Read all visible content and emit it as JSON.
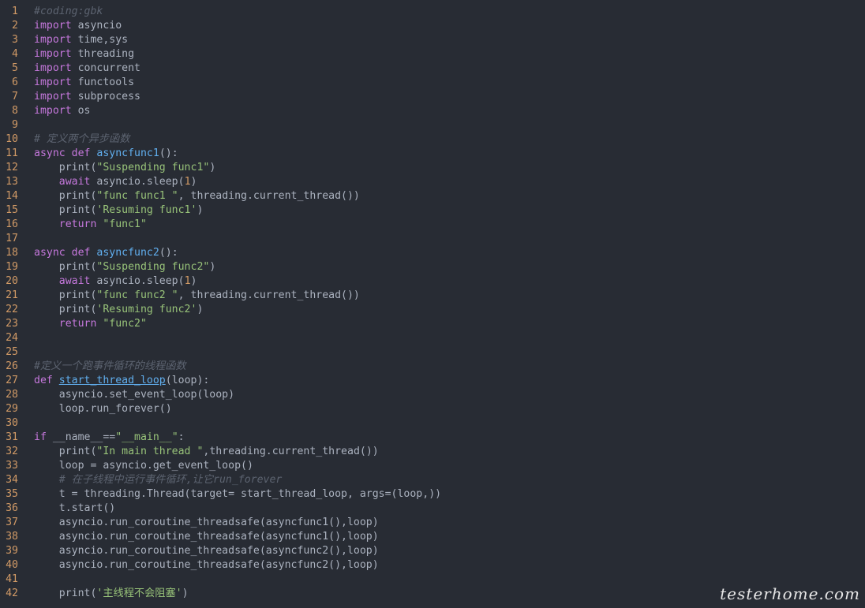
{
  "colors": {
    "background": "#282c34",
    "line_number": "#d19a66",
    "keyword": "#c678dd",
    "function": "#61afef",
    "string": "#98c379",
    "number": "#d19a66",
    "comment": "#5c6370",
    "text": "#abb2bf"
  },
  "lines": [
    {
      "n": "1",
      "tokens": [
        {
          "t": "#coding:gbk",
          "c": "cmt"
        }
      ]
    },
    {
      "n": "2",
      "tokens": [
        {
          "t": "import",
          "c": "kw"
        },
        {
          "t": " asyncio",
          "c": "plain"
        }
      ]
    },
    {
      "n": "3",
      "tokens": [
        {
          "t": "import",
          "c": "kw"
        },
        {
          "t": " time,sys",
          "c": "plain"
        }
      ]
    },
    {
      "n": "4",
      "tokens": [
        {
          "t": "import",
          "c": "kw"
        },
        {
          "t": " threading",
          "c": "plain"
        }
      ]
    },
    {
      "n": "5",
      "tokens": [
        {
          "t": "import",
          "c": "kw"
        },
        {
          "t": " concurrent",
          "c": "plain"
        }
      ]
    },
    {
      "n": "6",
      "tokens": [
        {
          "t": "import",
          "c": "kw"
        },
        {
          "t": " functools",
          "c": "plain"
        }
      ]
    },
    {
      "n": "7",
      "tokens": [
        {
          "t": "import",
          "c": "kw"
        },
        {
          "t": " subprocess",
          "c": "plain"
        }
      ]
    },
    {
      "n": "8",
      "tokens": [
        {
          "t": "import",
          "c": "kw"
        },
        {
          "t": " os",
          "c": "plain"
        }
      ]
    },
    {
      "n": "9",
      "tokens": []
    },
    {
      "n": "10",
      "tokens": [
        {
          "t": "# 定义两个异步函数",
          "c": "cmt"
        }
      ]
    },
    {
      "n": "11",
      "tokens": [
        {
          "t": "async def ",
          "c": "kw"
        },
        {
          "t": "asyncfunc1",
          "c": "fn"
        },
        {
          "t": "():",
          "c": "plain"
        }
      ]
    },
    {
      "n": "12",
      "tokens": [
        {
          "t": "    print(",
          "c": "plain"
        },
        {
          "t": "\"Suspending func1\"",
          "c": "str"
        },
        {
          "t": ")",
          "c": "plain"
        }
      ]
    },
    {
      "n": "13",
      "tokens": [
        {
          "t": "    ",
          "c": "plain"
        },
        {
          "t": "await",
          "c": "kw"
        },
        {
          "t": " asyncio.sleep(",
          "c": "plain"
        },
        {
          "t": "1",
          "c": "num"
        },
        {
          "t": ")",
          "c": "plain"
        }
      ]
    },
    {
      "n": "14",
      "tokens": [
        {
          "t": "    print(",
          "c": "plain"
        },
        {
          "t": "\"func func1 \"",
          "c": "str"
        },
        {
          "t": ", threading.current_thread())",
          "c": "plain"
        }
      ]
    },
    {
      "n": "15",
      "tokens": [
        {
          "t": "    print(",
          "c": "plain"
        },
        {
          "t": "'Resuming func1'",
          "c": "str"
        },
        {
          "t": ")",
          "c": "plain"
        }
      ]
    },
    {
      "n": "16",
      "tokens": [
        {
          "t": "    ",
          "c": "plain"
        },
        {
          "t": "return",
          "c": "kw"
        },
        {
          "t": " ",
          "c": "plain"
        },
        {
          "t": "\"func1\"",
          "c": "str"
        }
      ]
    },
    {
      "n": "17",
      "tokens": []
    },
    {
      "n": "18",
      "tokens": [
        {
          "t": "async def ",
          "c": "kw"
        },
        {
          "t": "asyncfunc2",
          "c": "fn"
        },
        {
          "t": "():",
          "c": "plain"
        }
      ]
    },
    {
      "n": "19",
      "tokens": [
        {
          "t": "    print(",
          "c": "plain"
        },
        {
          "t": "\"Suspending func2\"",
          "c": "str"
        },
        {
          "t": ")",
          "c": "plain"
        }
      ]
    },
    {
      "n": "20",
      "tokens": [
        {
          "t": "    ",
          "c": "plain"
        },
        {
          "t": "await",
          "c": "kw"
        },
        {
          "t": " asyncio.sleep(",
          "c": "plain"
        },
        {
          "t": "1",
          "c": "num"
        },
        {
          "t": ")",
          "c": "plain"
        }
      ]
    },
    {
      "n": "21",
      "tokens": [
        {
          "t": "    print(",
          "c": "plain"
        },
        {
          "t": "\"func func2 \"",
          "c": "str"
        },
        {
          "t": ", threading.current_thread())",
          "c": "plain"
        }
      ]
    },
    {
      "n": "22",
      "tokens": [
        {
          "t": "    print(",
          "c": "plain"
        },
        {
          "t": "'Resuming func2'",
          "c": "str"
        },
        {
          "t": ")",
          "c": "plain"
        }
      ]
    },
    {
      "n": "23",
      "tokens": [
        {
          "t": "    ",
          "c": "plain"
        },
        {
          "t": "return",
          "c": "kw"
        },
        {
          "t": " ",
          "c": "plain"
        },
        {
          "t": "\"func2\"",
          "c": "str"
        }
      ]
    },
    {
      "n": "24",
      "tokens": []
    },
    {
      "n": "25",
      "tokens": []
    },
    {
      "n": "26",
      "tokens": [
        {
          "t": "#定义一个跑事件循环的线程函数",
          "c": "cmt"
        }
      ]
    },
    {
      "n": "27",
      "tokens": [
        {
          "t": "def ",
          "c": "kw"
        },
        {
          "t": "start_thread_loop",
          "c": "fn ul"
        },
        {
          "t": "(loop):",
          "c": "plain"
        }
      ]
    },
    {
      "n": "28",
      "tokens": [
        {
          "t": "    asyncio.set_event_loop(loop)",
          "c": "plain"
        }
      ]
    },
    {
      "n": "29",
      "tokens": [
        {
          "t": "    loop.run_forever()",
          "c": "plain"
        }
      ]
    },
    {
      "n": "30",
      "tokens": []
    },
    {
      "n": "31",
      "tokens": [
        {
          "t": "if",
          "c": "kw"
        },
        {
          "t": " __name__==",
          "c": "plain"
        },
        {
          "t": "\"__main__\"",
          "c": "str"
        },
        {
          "t": ":",
          "c": "plain"
        }
      ]
    },
    {
      "n": "32",
      "tokens": [
        {
          "t": "    print(",
          "c": "plain"
        },
        {
          "t": "\"In main thread \"",
          "c": "str"
        },
        {
          "t": ",threading.current_thread())",
          "c": "plain"
        }
      ]
    },
    {
      "n": "33",
      "tokens": [
        {
          "t": "    loop = asyncio.get_event_loop()",
          "c": "plain"
        }
      ]
    },
    {
      "n": "34",
      "tokens": [
        {
          "t": "    # 在子线程中运行事件循环,让它run_forever",
          "c": "cmt"
        }
      ]
    },
    {
      "n": "35",
      "tokens": [
        {
          "t": "    t = threading.Thread(target= start_thread_loop, args=(loop,))",
          "c": "plain"
        }
      ]
    },
    {
      "n": "36",
      "tokens": [
        {
          "t": "    t.start()",
          "c": "plain"
        }
      ]
    },
    {
      "n": "37",
      "tokens": [
        {
          "t": "    asyncio.run_coroutine_threadsafe(asyncfunc1(),loop)",
          "c": "plain"
        }
      ]
    },
    {
      "n": "38",
      "tokens": [
        {
          "t": "    asyncio.run_coroutine_threadsafe(asyncfunc1(),loop)",
          "c": "plain"
        }
      ]
    },
    {
      "n": "39",
      "tokens": [
        {
          "t": "    asyncio.run_coroutine_threadsafe(asyncfunc2(),loop)",
          "c": "plain"
        }
      ]
    },
    {
      "n": "40",
      "tokens": [
        {
          "t": "    asyncio.run_coroutine_threadsafe(asyncfunc2(),loop)",
          "c": "plain"
        }
      ]
    },
    {
      "n": "41",
      "tokens": []
    },
    {
      "n": "42",
      "tokens": [
        {
          "t": "    print(",
          "c": "plain"
        },
        {
          "t": "'主线程不会阻塞'",
          "c": "str"
        },
        {
          "t": ")",
          "c": "plain"
        }
      ]
    }
  ],
  "watermark": "testerhome.com"
}
